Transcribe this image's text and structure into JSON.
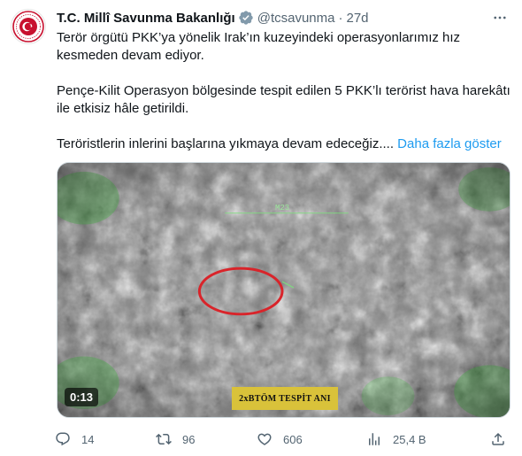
{
  "tweet": {
    "author_name": "T.C. Millî Savunma Bakanlığı",
    "handle": "@tcsavunma",
    "separator": "·",
    "time": "27d",
    "paragraph1": "Terör örgütü PKK’ya yönelik Irak’ın kuzeyindeki operasyonlarımız hız kesmeden devam ediyor.",
    "paragraph2": "Pençe-Kilit Operasyon bölgesinde tespit edilen 5 PKK’lı terörist hava harekâtı ile etkisiz hâle getirildi.",
    "paragraph3": "Teröristlerin inlerini başlarına yıkmaya devam edeceğiz....",
    "show_more": "Daha fazla göster"
  },
  "media": {
    "duration": "0:13",
    "caption": "2xBTÖM TESPİT ANI",
    "hud_label": "M23"
  },
  "actions": {
    "replies": "14",
    "retweets": "96",
    "likes": "606",
    "views": "25,4 B"
  },
  "colors": {
    "accent": "#1d9bf0",
    "secondary_text": "#536471",
    "verified_badge": "#829aab",
    "logo_red": "#c8102e",
    "target_circle": "#d9242a"
  },
  "icons": [
    "ministry-logo",
    "verified-icon",
    "more-icon",
    "reply-icon",
    "retweet-icon",
    "like-icon",
    "views-icon",
    "share-icon"
  ]
}
